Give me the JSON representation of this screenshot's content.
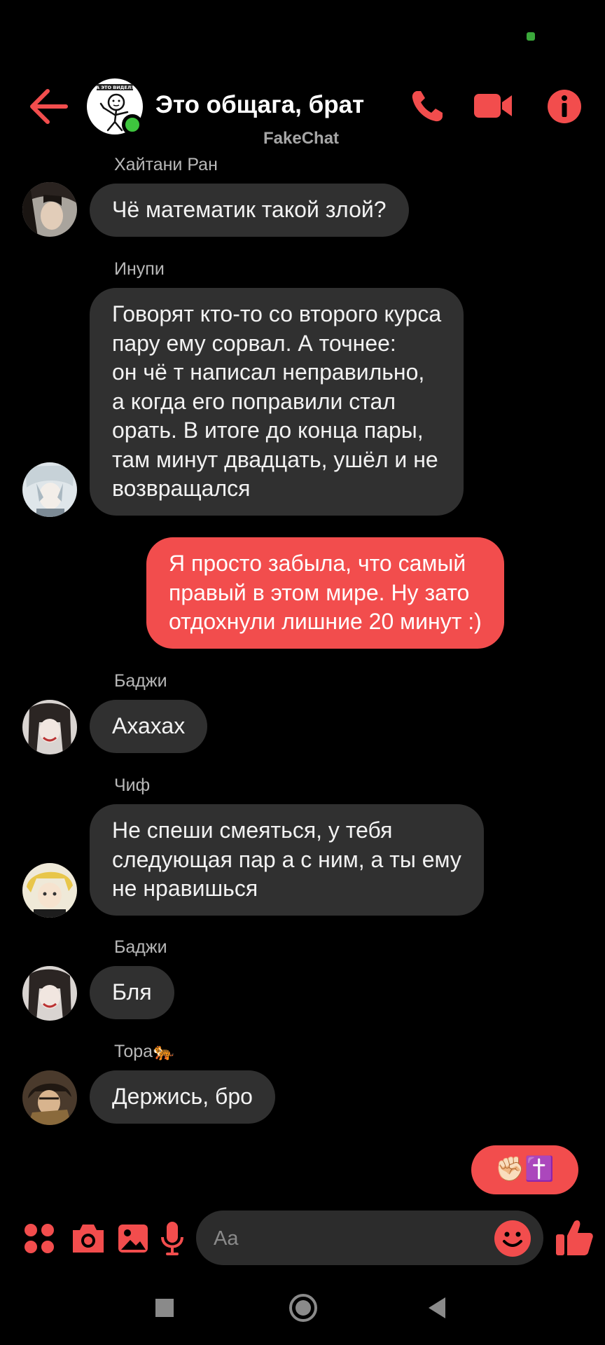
{
  "header": {
    "title": "Это общага, брат",
    "subtitle": "FakeChat",
    "avatar_caption": "А ЭТО ВИДЕЛ?"
  },
  "messages": [
    {
      "sender": "Хайтани Ран",
      "lines": [
        "Чё математик такой злой?"
      ]
    },
    {
      "sender": "Инупи",
      "lines": [
        "Говорят кто-то со второго курса",
        "пару ему сорвал. А точнее:",
        "он чё т написал неправильно,",
        "а когда его поправили стал",
        "орать. В итоге до конца пары,",
        "там минут двадцать, ушёл и не",
        "возвращался"
      ]
    },
    {
      "sender": "",
      "mine": true,
      "lines": [
        "Я просто забыла, что самый",
        "правый в этом мире. Ну зато",
        "отдохнули лишние 20 минут :)"
      ]
    },
    {
      "sender": "Баджи",
      "lines": [
        "Ахахах"
      ]
    },
    {
      "sender": "Чиф",
      "lines": [
        "Не спеши смеяться, у тебя",
        "следующая пар а с ним, а ты ему",
        "не нравишься"
      ]
    },
    {
      "sender": "Баджи",
      "lines": [
        "Бля"
      ]
    },
    {
      "sender": "Тора🐅",
      "lines": [
        "Держись, бро"
      ]
    },
    {
      "sender": "",
      "mine": true,
      "lines": [
        "✊🏻✝️"
      ]
    }
  ],
  "composer": {
    "placeholder": "Aa"
  },
  "colors": {
    "accent": "#f24d4d",
    "bubble_received": "#303030",
    "background": "#000000",
    "online": "#3ec53e"
  },
  "icons": [
    "back-arrow-icon",
    "phone-icon",
    "video-camera-icon",
    "info-icon",
    "apps-grid-icon",
    "camera-icon",
    "gallery-icon",
    "microphone-icon",
    "emoji-icon",
    "thumbs-up-icon",
    "nav-square-icon",
    "nav-home-icon",
    "nav-back-icon"
  ]
}
